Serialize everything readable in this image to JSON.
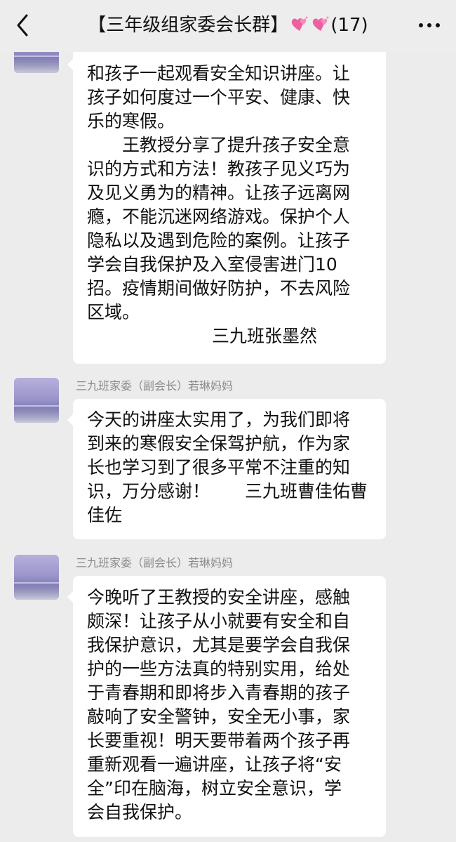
{
  "header": {
    "title_text": "【三年级组家委会长群】",
    "member_count": "(17)",
    "back_icon": "chevron-left-icon",
    "more_icon": "more-dots-icon",
    "heart_icon": "sparkling-hearts-icon",
    "heart_color": "#ee5fa0"
  },
  "messages": [
    {
      "sender": "",
      "lines": [
        "和孩子一起观看安全知识讲座。让",
        "孩子如何度过一个平安、健康、快",
        "乐的寒假。",
        "王教授分享了提升孩子安全意",
        "识的方式和方法！教孩子见义巧为",
        "及见义勇为的精神。让孩子远离网",
        "瘾，不能沉迷网络游戏。保护个人",
        "隐私以及遇到危险的案例。让孩子",
        "学会自我保护及入室侵害进门10",
        "招。疫情期间做好防护，不去风险",
        "区域。",
        "三九班张墨然"
      ]
    },
    {
      "sender": "三九班家委（副会长）若琳妈妈",
      "lines": [
        "今天的讲座太实用了，为我们即将",
        "到来的寒假安全保驾护航，作为家",
        "长也学习到了很多平常不注重的知",
        "识，万分感谢！　　三九班曹佳佑曹",
        "佳佐"
      ]
    },
    {
      "sender": "三九班家委（副会长）若琳妈妈",
      "lines": [
        "今晚听了王教授的安全讲座，感触",
        "颇深！让孩子从小就要有安全和自",
        "我保护意识，尤其是要学会自我保",
        "护的一些方法真的特别实用，给处",
        "于青春期和即将步入青春期的孩子",
        "敲响了安全警钟，安全无小事，家",
        "长要重视！明天要带着两个孩子再",
        "重新观看一遍讲座，让孩子将“安",
        "全”印在脑海，树立安全意识，学",
        "会自我保护。"
      ]
    }
  ]
}
